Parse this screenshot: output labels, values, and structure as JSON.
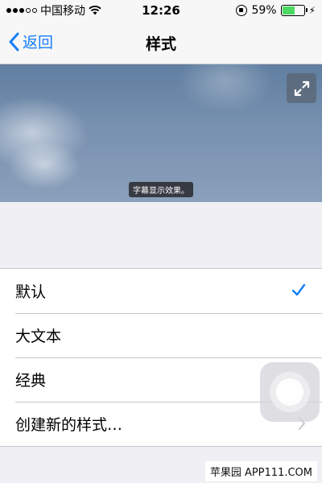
{
  "status_bar": {
    "carrier": "中国移动",
    "time": "12:26",
    "battery_percent": "59%",
    "battery_level": 0.59
  },
  "nav": {
    "back_label": "返回",
    "title": "样式"
  },
  "preview": {
    "subtitle_text": "字幕显示效果。"
  },
  "list": {
    "items": [
      {
        "label": "默认",
        "accessory": "checkmark-icon"
      },
      {
        "label": "大文本",
        "accessory": ""
      },
      {
        "label": "经典",
        "accessory": ""
      },
      {
        "label": "创建新的样式…",
        "accessory": "disclosure-chevron-icon"
      }
    ]
  },
  "watermark": "苹果园 APP111.COM",
  "colors": {
    "accent": "#147efb",
    "background": "#efeff4",
    "battery": "#4cd964"
  }
}
